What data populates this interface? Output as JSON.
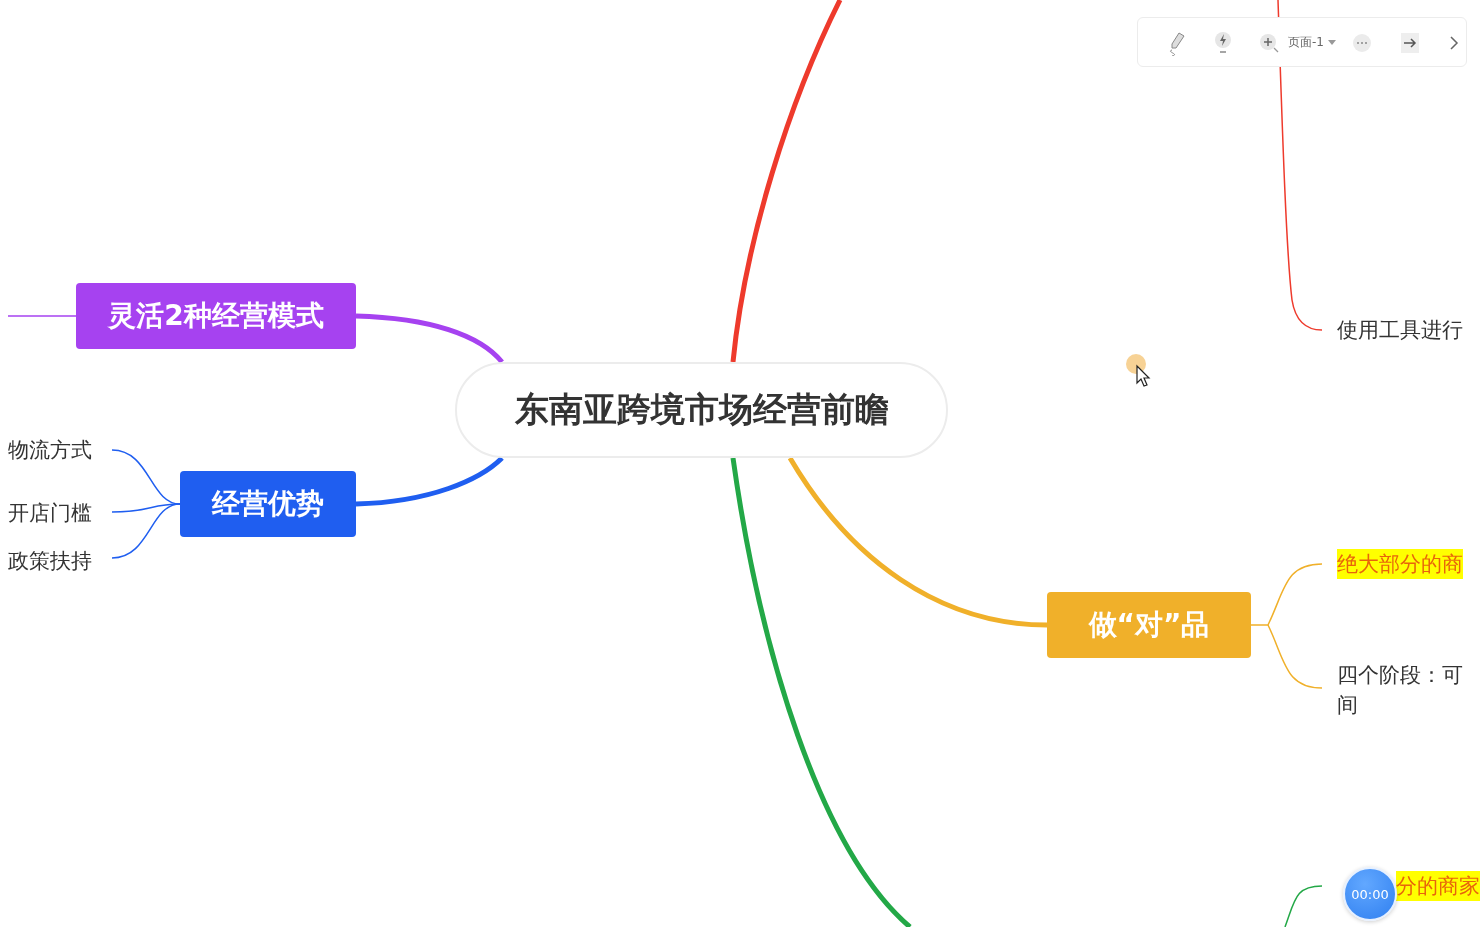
{
  "toolbar": {
    "page_label": "页面-1"
  },
  "map": {
    "central": "东南亚跨境市场经营前瞻",
    "branches": [
      {
        "title": "灵活2种经营模式",
        "color": "#a642f0"
      },
      {
        "title": "经营优势",
        "color": "#1f5ef0",
        "children": [
          {
            "text": "物流方式",
            "highlighted": false
          },
          {
            "text": "开店门槛",
            "highlighted": false
          },
          {
            "text": "政策扶持",
            "highlighted": false
          }
        ]
      },
      {
        "color": "#ee3a2c",
        "children": [
          {
            "text": "使用工具进行",
            "highlighted": false
          }
        ]
      },
      {
        "title": "做“对”品",
        "color": "#f0b02a",
        "children": [
          {
            "text": "绝大部分的商",
            "highlighted": true
          },
          {
            "text": "四个阶段：可间",
            "highlighted": false
          }
        ]
      },
      {
        "color": "#23a847",
        "children": [
          {
            "text": "分的商家",
            "highlighted": true
          }
        ]
      }
    ]
  },
  "timer": {
    "time": "00:00"
  }
}
